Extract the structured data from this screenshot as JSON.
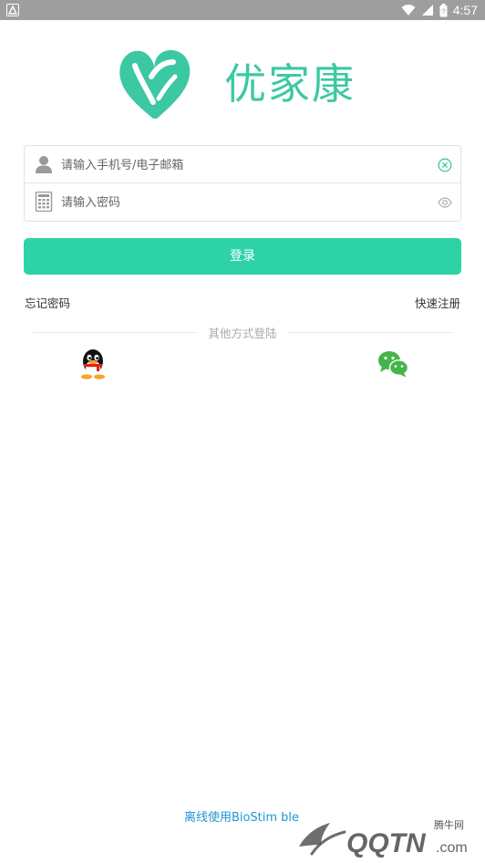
{
  "status_bar": {
    "time": "4:57",
    "icons": [
      "notification-icon",
      "wifi-icon",
      "cell-signal-icon",
      "battery-icon"
    ]
  },
  "app": {
    "name": "优家康",
    "brand_color": "#3cc8a2"
  },
  "form": {
    "account_placeholder": "请输入手机号/电子邮箱",
    "password_placeholder": "请输入密码",
    "account_value": "",
    "password_value": ""
  },
  "login_button": {
    "label": "登录",
    "color": "#2dd3a6"
  },
  "links": {
    "forgot_password": "忘记密码",
    "register": "快速注册"
  },
  "other_login": {
    "label": "其他方式登陆",
    "options": [
      "qq-icon",
      "wechat-icon"
    ]
  },
  "footer": {
    "offline_link": "离线使用BioStim ble"
  },
  "watermark": {
    "text": "腾牛网",
    "logo_text": "QQTN.com"
  }
}
